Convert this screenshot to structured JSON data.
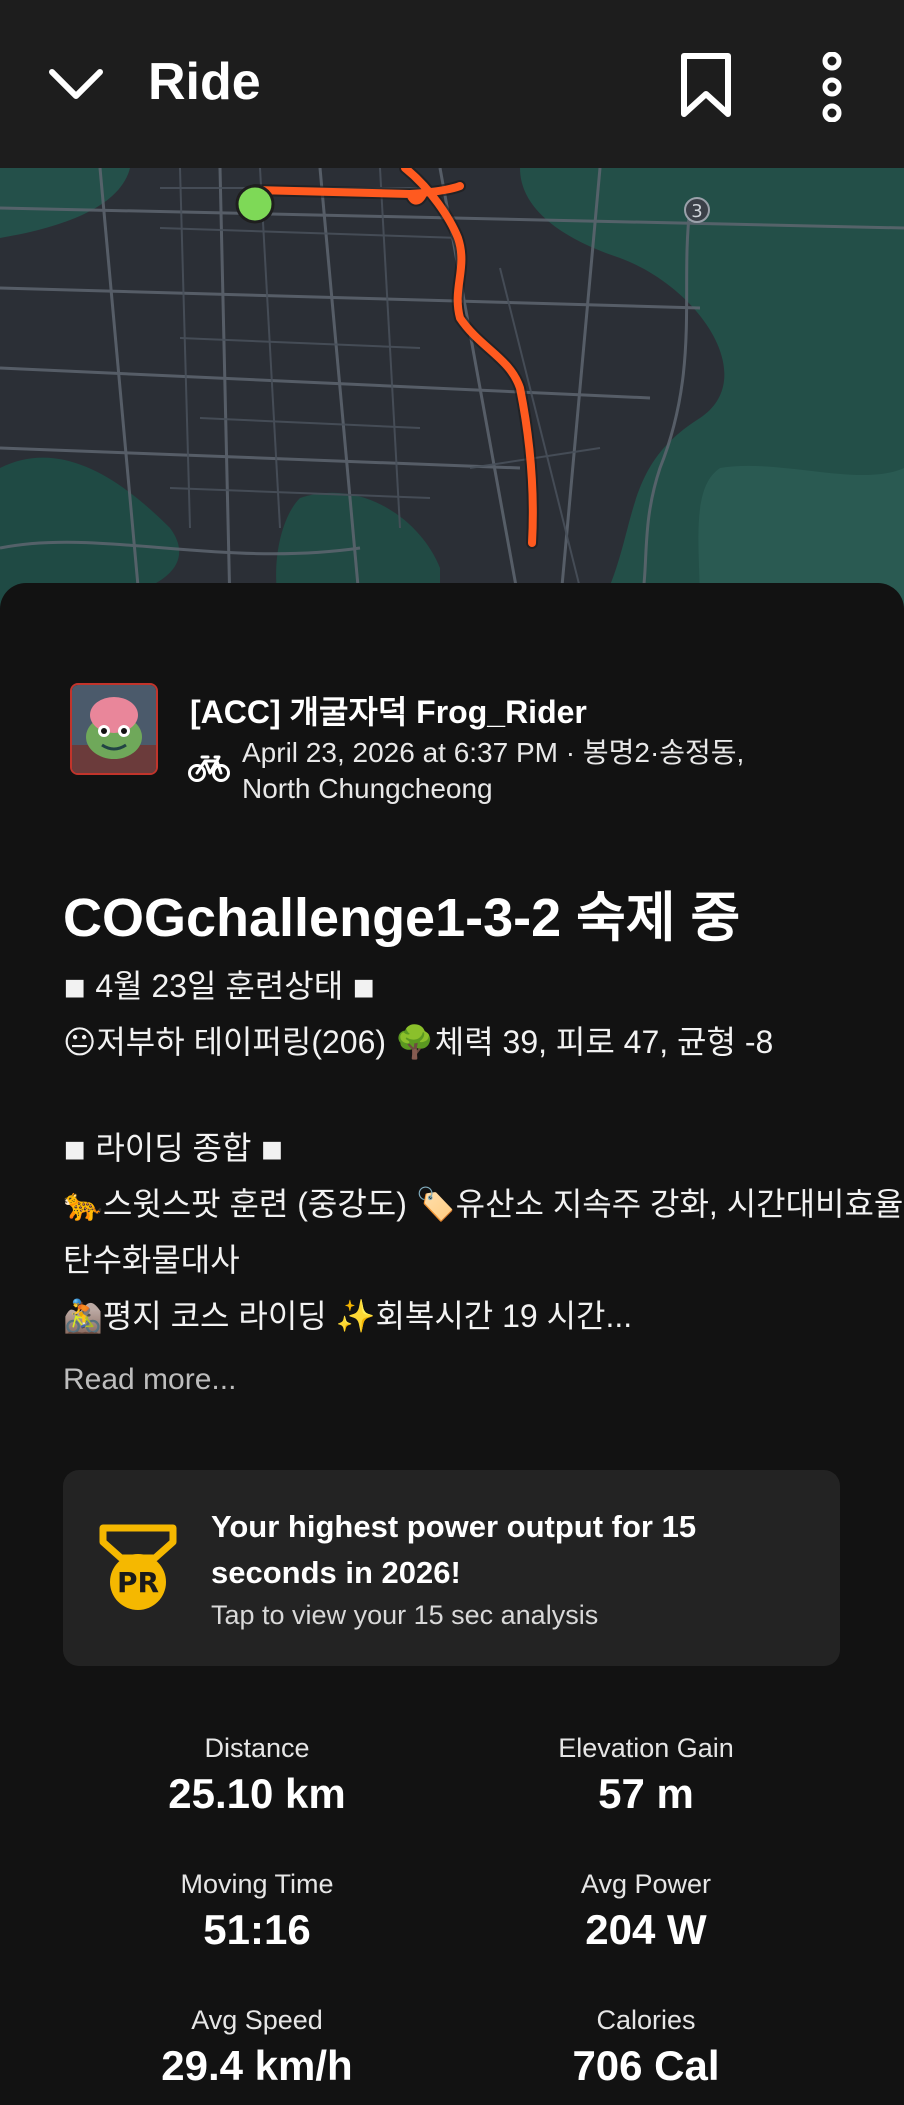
{
  "header": {
    "title": "Ride",
    "back_icon": "chevron-down-icon",
    "bookmark_icon": "bookmark-icon",
    "menu_icon": "more-vertical-icon"
  },
  "map": {
    "route_color": "#ff5a1f",
    "start_marker_color": "#7ed957",
    "road_label": "3"
  },
  "athlete": {
    "name": "[ACC] 개굴자덕 Frog_Rider",
    "activity_icon": "bike-icon",
    "date_location": "April 23, 2026 at 6:37 PM · 봉명2·송정동, North Chungcheong"
  },
  "activity": {
    "title": "COGchallenge1-3-2 숙제 중",
    "description_lines": [
      "◾ 4월 23일 훈련상태 ◾",
      "😐저부하 테이퍼링(206) 🌳체력 39, 피로 47, 균형 -8",
      "",
      "◾ 라이딩 종합 ◾",
      "🐆스윗스팟 훈련 (중강도) 🏷️유산소 지속주 강화, 시간대비효율,",
      "탄수화물대사",
      "🚵평지 코스 라이딩 ✨회복시간 19 시간..."
    ],
    "read_more": "Read more..."
  },
  "pr_card": {
    "badge_text": "PR",
    "badge_color": "#f5b800",
    "title": "Your highest power output for 15 seconds in 2026!",
    "subtitle": "Tap to view your 15 sec analysis"
  },
  "stats": [
    {
      "label": "Distance",
      "value": "25.10 km"
    },
    {
      "label": "Elevation Gain",
      "value": "57 m"
    },
    {
      "label": "Moving Time",
      "value": "51:16"
    },
    {
      "label": "Avg Power",
      "value": "204 W"
    },
    {
      "label": "Avg Speed",
      "value": "29.4 km/h"
    },
    {
      "label": "Calories",
      "value": "706 Cal"
    }
  ]
}
